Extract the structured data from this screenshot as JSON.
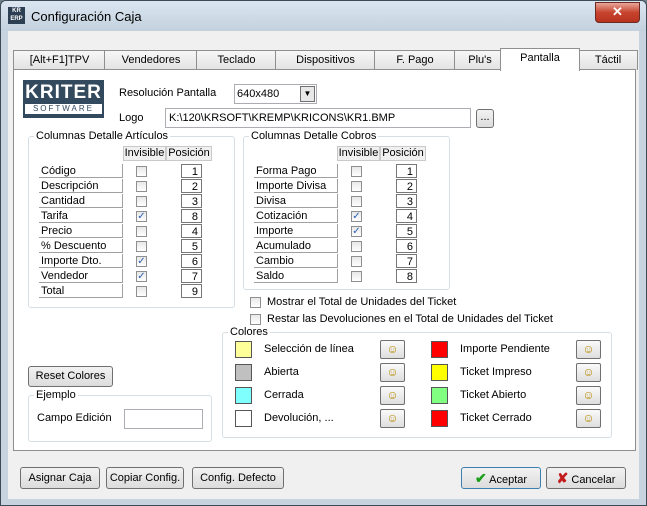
{
  "window": {
    "title": "Configuración Caja",
    "icon_text": "KR ERP",
    "close_glyph": "✕"
  },
  "tabs": [
    {
      "label": "[Alt+F1]TPV"
    },
    {
      "label": "Vendedores"
    },
    {
      "label": "Teclado"
    },
    {
      "label": "Dispositivos"
    },
    {
      "label": "F. Pago"
    },
    {
      "label": "Plu's"
    },
    {
      "label": "Pantalla",
      "active": true
    },
    {
      "label": "Táctil"
    }
  ],
  "logo": {
    "line1": "KRITER",
    "line2": "SOFTWARE"
  },
  "resolution": {
    "label": "Resolución Pantalla",
    "value": "640x480"
  },
  "logo_field": {
    "label": "Logo",
    "value": "K:\\120\\KRSOFT\\KREMP\\KRICONS\\KR1.BMP",
    "browse": "..."
  },
  "articles": {
    "title": "Columnas Detalle Artículos",
    "col_invisible": "Invisible",
    "col_position": "Posición",
    "rows": [
      {
        "name": "Código",
        "invisible": false,
        "pos": "1"
      },
      {
        "name": "Descripción",
        "invisible": false,
        "pos": "2"
      },
      {
        "name": "Cantidad",
        "invisible": false,
        "pos": "3"
      },
      {
        "name": "Tarifa",
        "invisible": true,
        "pos": "8"
      },
      {
        "name": "Precio",
        "invisible": false,
        "pos": "4"
      },
      {
        "name": "% Descuento",
        "invisible": false,
        "pos": "5"
      },
      {
        "name": "Importe Dto.",
        "invisible": true,
        "pos": "6"
      },
      {
        "name": "Vendedor",
        "invisible": true,
        "pos": "7"
      },
      {
        "name": "Total",
        "invisible": false,
        "pos": "9"
      }
    ]
  },
  "payments": {
    "title": "Columnas Detalle Cobros",
    "col_invisible": "Invisible",
    "col_position": "Posición",
    "rows": [
      {
        "name": "Forma Pago",
        "invisible": false,
        "pos": "1"
      },
      {
        "name": "Importe Divisa",
        "invisible": false,
        "pos": "2"
      },
      {
        "name": "Divisa",
        "invisible": false,
        "pos": "3"
      },
      {
        "name": "Cotización",
        "invisible": true,
        "pos": "4"
      },
      {
        "name": "Importe",
        "invisible": true,
        "pos": "5"
      },
      {
        "name": "Acumulado",
        "invisible": false,
        "pos": "6"
      },
      {
        "name": "Cambio",
        "invisible": false,
        "pos": "7"
      },
      {
        "name": "Saldo",
        "invisible": false,
        "pos": "8"
      }
    ]
  },
  "options": {
    "show_total_units": "Mostrar el Total de Unidades del Ticket",
    "subtract_returns": "Restar las Devoluciones en el Total de Unidades del Ticket"
  },
  "colors": {
    "title": "Colores",
    "items": [
      {
        "label": "Selección de línea",
        "color": "#ffff99"
      },
      {
        "label": "Abierta",
        "color": "#c0c0c0"
      },
      {
        "label": "Cerrada",
        "color": "#80ffff"
      },
      {
        "label": "Devolución, ...",
        "color": "#ffffff"
      },
      {
        "label": "Importe Pendiente",
        "color": "#ff0000"
      },
      {
        "label": "Ticket Impreso",
        "color": "#ffff00"
      },
      {
        "label": "Ticket Abierto",
        "color": "#80ff80"
      },
      {
        "label": "Ticket Cerrado",
        "color": "#ff0000"
      }
    ]
  },
  "reset_colors": "Reset Colores",
  "example": {
    "title": "Ejemplo",
    "field_label": "Campo Edición",
    "field_value": ""
  },
  "footer": {
    "assign": "Asignar Caja",
    "copy": "Copiar Config.",
    "default": "Config. Defecto",
    "accept": "Aceptar",
    "cancel": "Cancelar"
  }
}
